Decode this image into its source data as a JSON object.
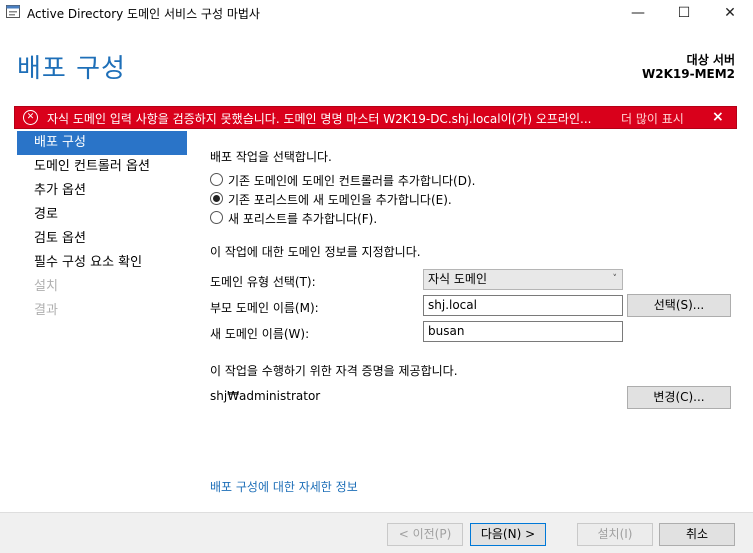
{
  "window": {
    "title": "Active Directory 도메인 서비스 구성 마법사",
    "minimize": "—",
    "maximize": "☐",
    "close": "✕"
  },
  "header": {
    "page_title": "배포 구성",
    "target_label": "대상 서버",
    "target_name": "W2K19-MEM2"
  },
  "error": {
    "icon": "✕",
    "message": "자식 도메인 입력 사항을 검증하지 못했습니다. 도메인 명명 마스터 W2K19-DC.shj.local이(가) 오프라인...",
    "more_link": "더 많이 표시",
    "close": "×",
    "bg_color": "#d9001b"
  },
  "nav": {
    "items": [
      {
        "label": "배포 구성"
      },
      {
        "label": "도메인 컨트롤러 옵션"
      },
      {
        "label": "추가 옵션"
      },
      {
        "label": "경로"
      },
      {
        "label": "검토 옵션"
      },
      {
        "label": "필수 구성 요소 확인"
      },
      {
        "label": "설치"
      },
      {
        "label": "결과"
      }
    ]
  },
  "content": {
    "select_operation": "배포 작업을 선택합니다.",
    "options": [
      {
        "label": "기존 도메인에 도메인 컨트롤러를 추가합니다(D).",
        "selected": false
      },
      {
        "label": "기존 포리스트에 새 도메인을 추가합니다(E).",
        "selected": true
      },
      {
        "label": "새 포리스트를 추가합니다(F).",
        "selected": false
      }
    ],
    "specify_info": "이 작업에 대한 도메인 정보를 지정합니다.",
    "domain_type_label": "도메인 유형 선택(T):",
    "domain_type_value": "자식 도메인",
    "parent_domain_label": "부모 도메인 이름(M):",
    "parent_domain_value": "shj.local",
    "select_button": "선택(S)...",
    "new_domain_label": "새 도메인 이름(W):",
    "new_domain_value": "busan",
    "credentials_text": "이 작업을 수행하기 위한 자격 증명을 제공합니다.",
    "credential_user": "shj₩administrator",
    "change_button": "변경(C)...",
    "more_info_link": "배포 구성에 대한 자세한 정보"
  },
  "footer": {
    "prev": "< 이전(P)",
    "next": "다음(N) >",
    "install": "설치(I)",
    "cancel": "취소"
  }
}
